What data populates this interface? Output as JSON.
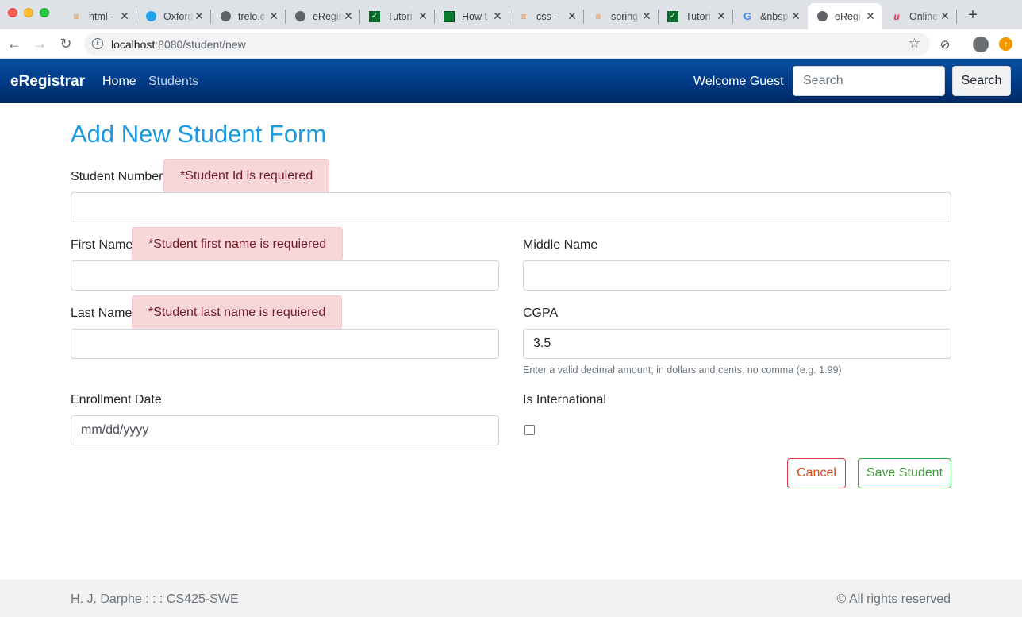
{
  "browser": {
    "tabs": [
      {
        "title": "html -",
        "icon": "stackoverflow-icon"
      },
      {
        "title": "Oxford",
        "icon": "oxford-icon"
      },
      {
        "title": "trelo.c",
        "icon": "globe-icon"
      },
      {
        "title": "eRegis",
        "icon": "globe-icon"
      },
      {
        "title": "Tutori",
        "icon": "checkmark-green-icon"
      },
      {
        "title": "How t",
        "icon": "green-box-icon"
      },
      {
        "title": "css -",
        "icon": "stackoverflow-icon"
      },
      {
        "title": "spring",
        "icon": "stackoverflow-icon"
      },
      {
        "title": "Tutori",
        "icon": "checkmark-green-icon"
      },
      {
        "title": "&nbsp",
        "icon": "google-icon"
      },
      {
        "title": "eRegi",
        "icon": "globe-icon",
        "active": true
      },
      {
        "title": "Online",
        "icon": "red-u-icon"
      }
    ],
    "url_host": "localhost",
    "url_path": ":8080/student/new"
  },
  "navbar": {
    "brand": "eRegistrar",
    "home": "Home",
    "students": "Students",
    "welcome": "Welcome Guest",
    "search_placeholder": "Search",
    "search_button": "Search"
  },
  "form": {
    "title": "Add New Student Form",
    "student_number": {
      "label": "Student Number",
      "error": "*Student Id is requiered",
      "value": ""
    },
    "first_name": {
      "label": "First Name",
      "error": "*Student first name is requiered",
      "value": ""
    },
    "middle_name": {
      "label": "Middle Name",
      "value": ""
    },
    "last_name": {
      "label": "Last Name",
      "error": "*Student last name is requiered",
      "value": ""
    },
    "cgpa": {
      "label": "CGPA",
      "value": "3.5",
      "help": "Enter a valid decimal amount; in dollars and cents; no comma (e.g. 1.99)"
    },
    "enrollment_date": {
      "label": "Enrollment Date",
      "placeholder": "mm/dd/yyyy"
    },
    "is_international": {
      "label": "Is International",
      "checked": false
    },
    "cancel": "Cancel",
    "save": "Save Student"
  },
  "footer": {
    "left": "H. J. Darphe : : : CS425-SWE",
    "right": "© All rights reserved"
  }
}
